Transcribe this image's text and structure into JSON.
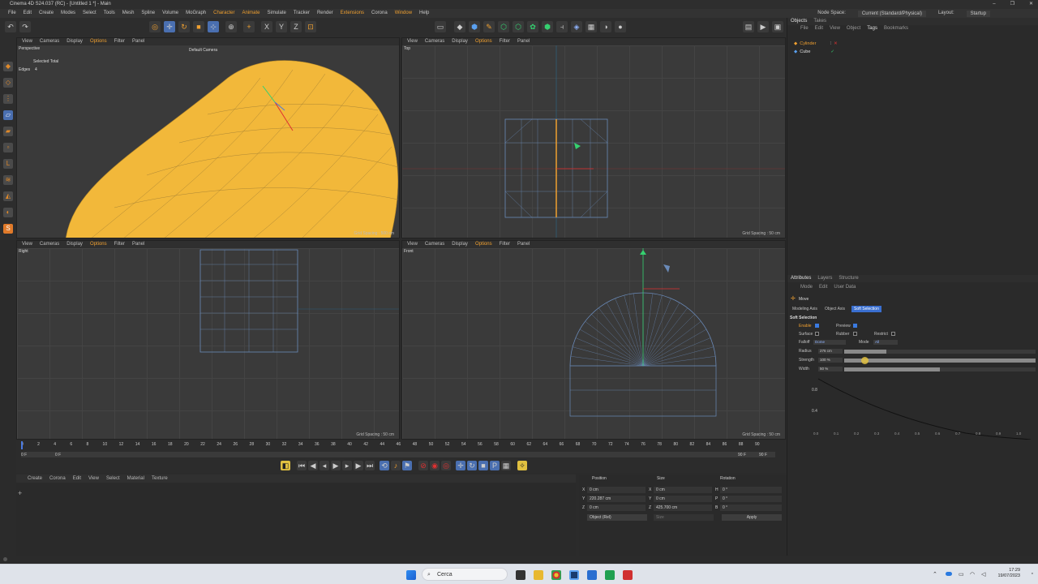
{
  "window": {
    "title": "Cinema 4D S24.037 (RC) - [Untitled 1 *] - Main",
    "controls": [
      "–",
      "❐",
      "✕"
    ]
  },
  "menu": {
    "items": [
      "File",
      "Edit",
      "Create",
      "Modes",
      "Select",
      "Tools",
      "Mesh",
      "Spline",
      "Volume",
      "MoGraph",
      "Character",
      "Animate",
      "Simulate",
      "Tracker",
      "Render",
      "Extensions",
      "Corona",
      "Window",
      "Help"
    ],
    "node_space_label": "Node Space:",
    "node_space_value": "Current (Standard/Physical)",
    "layout_label": "Layout:",
    "layout_value": "Startup"
  },
  "viewport_menu": [
    "View",
    "Cameras",
    "Display",
    "Options",
    "Filter",
    "Panel"
  ],
  "viewports": {
    "perspective": {
      "label": "Perspective",
      "camera": "Default Camera",
      "stats_title": "Selected Total",
      "stats_label": "Edges",
      "stats_value": "4",
      "grid": "Grid Spacing : 500 cm"
    },
    "top": {
      "label": "Top",
      "grid": "Grid Spacing : 50 cm"
    },
    "right": {
      "label": "Right",
      "grid": "Grid Spacing : 50 cm"
    },
    "front": {
      "label": "Front",
      "grid": "Grid Spacing : 50 cm"
    }
  },
  "timeline": {
    "ticks": [
      "0",
      "2",
      "4",
      "6",
      "8",
      "10",
      "12",
      "14",
      "16",
      "18",
      "20",
      "22",
      "24",
      "26",
      "28",
      "30",
      "32",
      "34",
      "36",
      "38",
      "40",
      "42",
      "44",
      "46",
      "48",
      "50",
      "52",
      "54",
      "56",
      "58",
      "60",
      "62",
      "64",
      "66",
      "68",
      "70",
      "72",
      "74",
      "76",
      "78",
      "80",
      "82",
      "84",
      "86",
      "88",
      "90"
    ],
    "start": "0 F",
    "current": "0 F",
    "end": "90 F",
    "end2": "90 F"
  },
  "material_menu": [
    "Create",
    "Corona",
    "Edit",
    "View",
    "Select",
    "Material",
    "Texture"
  ],
  "coordinates": {
    "headers": {
      "position": "Position",
      "size": "Size",
      "rotation": "Rotation"
    },
    "x": {
      "label": "X",
      "pos": "0 cm",
      "size_label": "X",
      "size": "0 cm",
      "rot_label": "H",
      "rot": "0 °"
    },
    "y": {
      "label": "Y",
      "pos": "220.287 cm",
      "size_label": "Y",
      "size": "0 cm",
      "rot_label": "P",
      "rot": "0 °"
    },
    "z": {
      "label": "Z",
      "pos": "0 cm",
      "size_label": "Z",
      "size": "425.700 cm",
      "rot_label": "B",
      "rot": "0 °"
    },
    "mode": "Object (Rel)",
    "size_mode": "Size",
    "apply": "Apply"
  },
  "objects_panel": {
    "tabs": [
      "Objects",
      "Takes"
    ],
    "menu": [
      "File",
      "Edit",
      "View",
      "Object",
      "Tags",
      "Bookmarks"
    ],
    "items": [
      {
        "name": "Cylinder"
      },
      {
        "name": "Cube"
      }
    ]
  },
  "attributes_panel": {
    "tabs": [
      "Attributes",
      "Layers",
      "Structure"
    ],
    "menu": [
      "Mode",
      "Edit",
      "User Data"
    ],
    "tool": "Move",
    "subtabs": [
      "Modeling Axis",
      "Object Axis",
      "Soft Selection"
    ],
    "section": "Soft Selection",
    "enable_label": "Enable",
    "enable": true,
    "preview_label": "Preview",
    "preview": true,
    "surface_label": "Surface",
    "rubber_label": "Rubber",
    "restrict_label": "Restrict",
    "falloff_label": "Falloff",
    "falloff_value": "Dome",
    "mode_label": "Mode",
    "mode_value": "All",
    "radius_label": "Radius",
    "radius_value": "276 cm",
    "radius_level": 0.22,
    "strength_label": "Strength",
    "strength_value": "100 %",
    "strength_level": 1.0,
    "width_label": "Width",
    "width_value": "50 %",
    "width_level": 0.5,
    "graph_y": [
      "0.8",
      "0.4"
    ],
    "graph_x": [
      "0.0",
      "0.1",
      "0.2",
      "0.3",
      "0.4",
      "0.5",
      "0.6",
      "0.7",
      "0.8",
      "0.9",
      "1.0"
    ]
  },
  "taskbar": {
    "search": "Cerca",
    "time": "17:29",
    "date": "19/07/2023"
  },
  "colors": {
    "accent": "#f0a030",
    "selection": "#3a7ae0",
    "object": "#f2b83a"
  }
}
